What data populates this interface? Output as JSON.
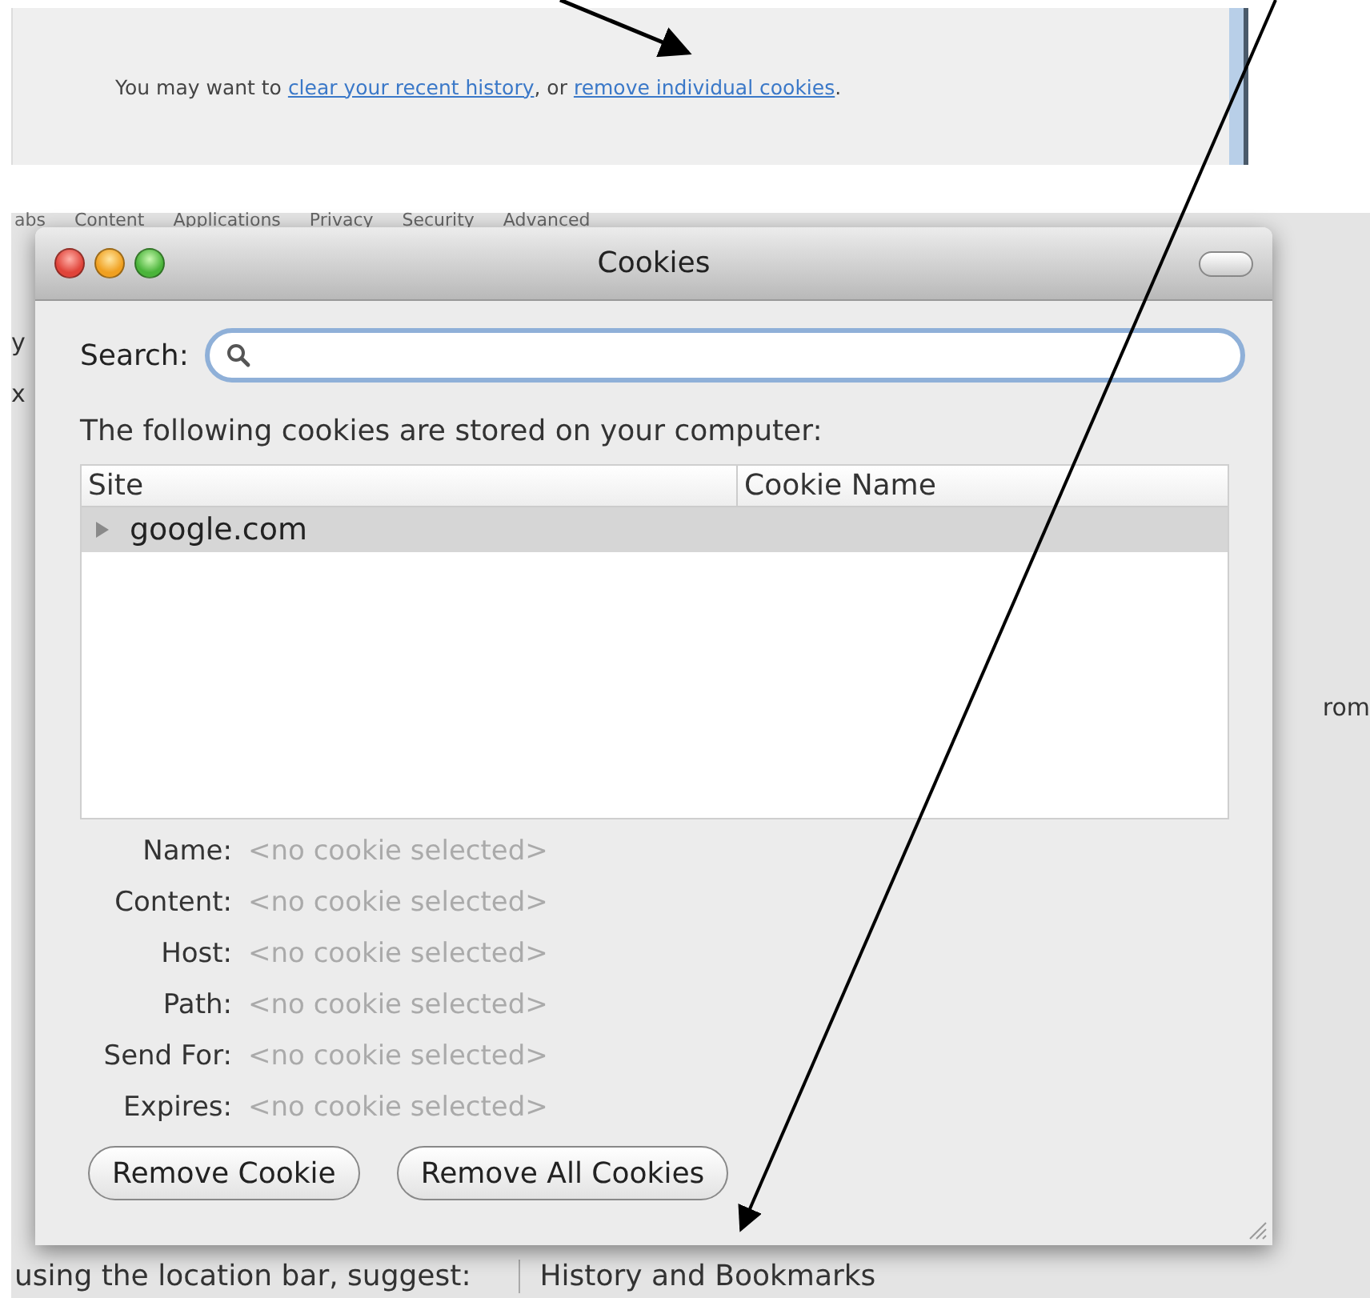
{
  "notice": {
    "parts": [
      {
        "kind": "text",
        "text": "You may want to "
      },
      {
        "kind": "link",
        "text": "clear your recent history"
      },
      {
        "kind": "text",
        "text": ", or "
      },
      {
        "kind": "link",
        "text": "remove individual cookies"
      },
      {
        "kind": "text",
        "text": "."
      }
    ]
  },
  "background": {
    "tabs": [
      "abs",
      "Content",
      "Applications",
      "Privacy",
      "Security",
      "Advanced"
    ],
    "left_fragments": [
      "y",
      "x"
    ],
    "right_fragment": "rom",
    "bottom_label": "using the location bar, suggest:",
    "bottom_popup": "History and Bookmarks"
  },
  "dialog": {
    "title": "Cookies",
    "search": {
      "label": "Search:"
    },
    "intro": "The following cookies are stored on your computer:",
    "columns": [
      "Site",
      "Cookie Name"
    ],
    "rows": [
      {
        "site": "google.com",
        "expanded": false,
        "selected": true
      }
    ],
    "details": [
      {
        "label": "Name:",
        "value": "<no cookie selected>"
      },
      {
        "label": "Content:",
        "value": "<no cookie selected>"
      },
      {
        "label": "Host:",
        "value": "<no cookie selected>"
      },
      {
        "label": "Path:",
        "value": "<no cookie selected>"
      },
      {
        "label": "Send For:",
        "value": "<no cookie selected>"
      },
      {
        "label": "Expires:",
        "value": "<no cookie selected>"
      }
    ],
    "buttons": [
      "Remove Cookie",
      "Remove All Cookies"
    ]
  }
}
